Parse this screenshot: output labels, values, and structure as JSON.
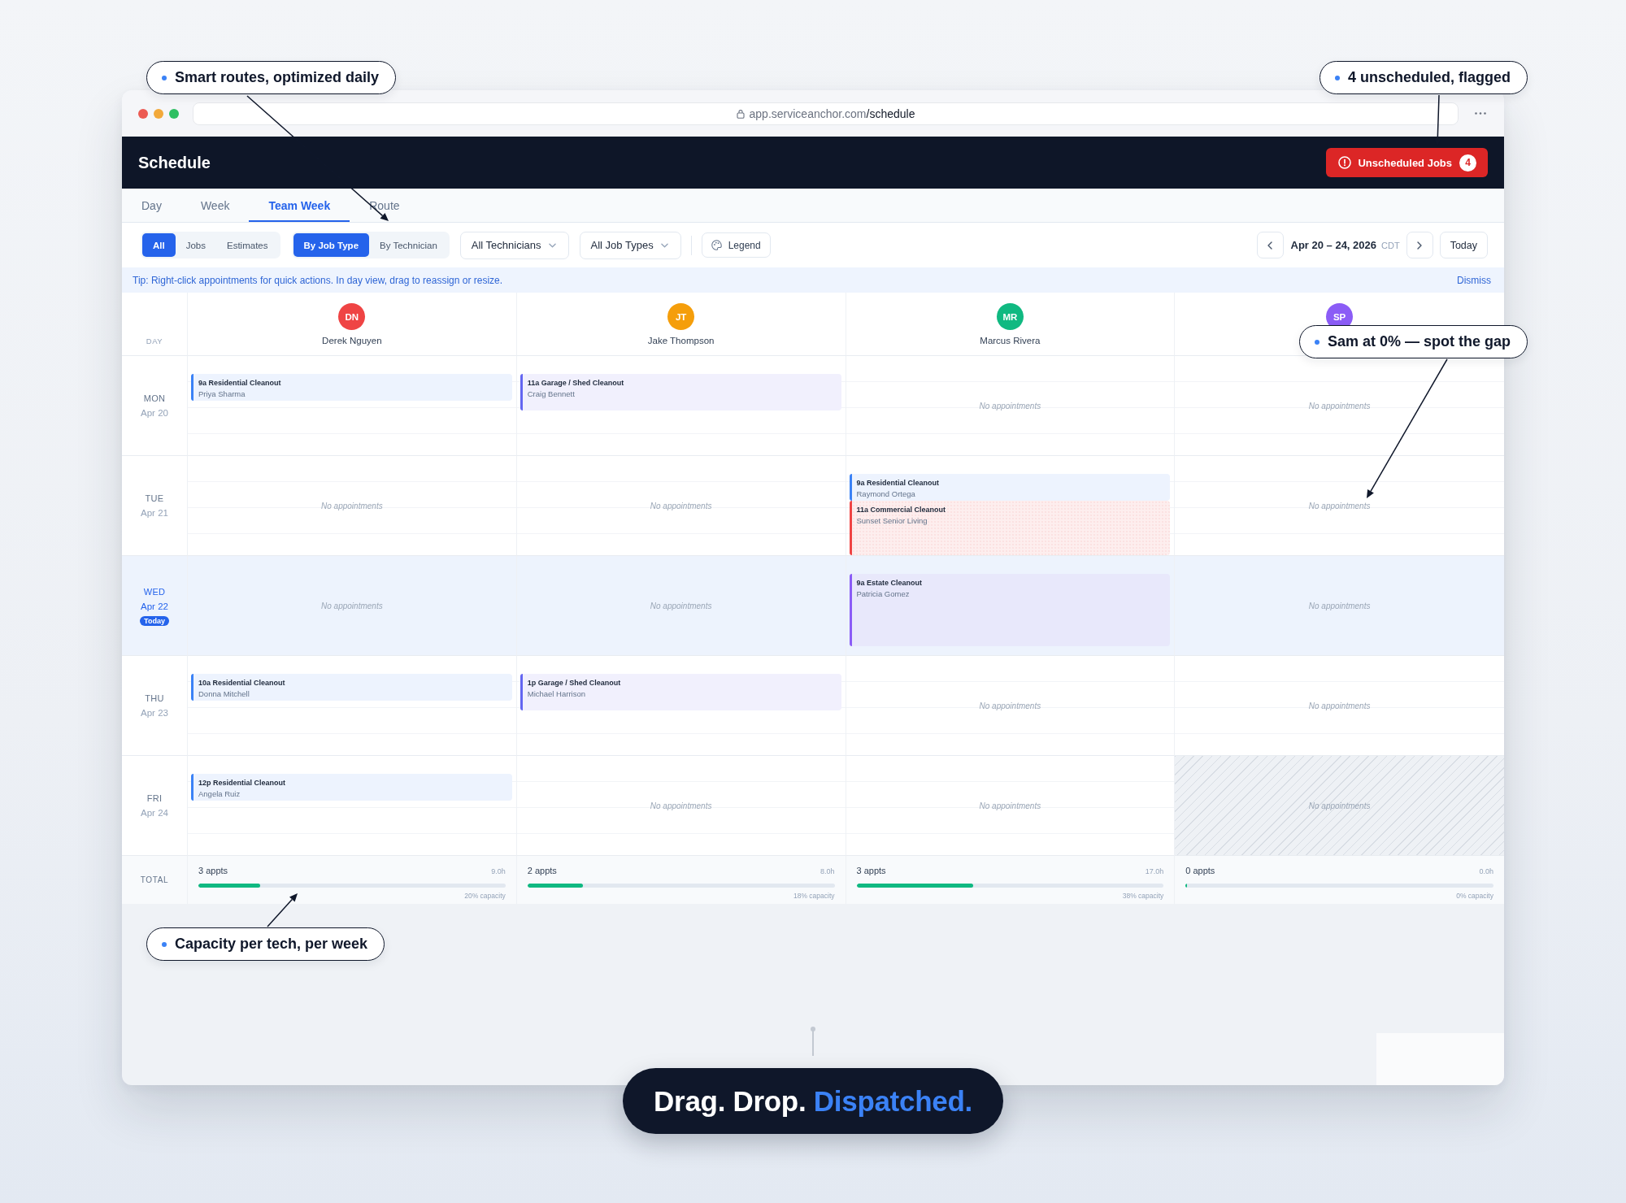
{
  "callouts": [
    {
      "text": "Smart routes, optimized daily"
    },
    {
      "text": "4 unscheduled, flagged"
    },
    {
      "text": "Sam at 0% — spot the gap"
    },
    {
      "text": "Capacity per tech, per week"
    }
  ],
  "browser": {
    "url": {
      "host": "app.serviceanchor.com",
      "path": "/schedule"
    }
  },
  "header": {
    "title": "Schedule",
    "alert_button": {
      "label": "Unscheduled Jobs",
      "count": "4"
    }
  },
  "tabs": [
    {
      "label": "Day",
      "selected": false
    },
    {
      "label": "Week",
      "selected": false
    },
    {
      "label": "Team Week",
      "selected": true
    },
    {
      "label": "Route",
      "selected": false
    }
  ],
  "toolbar": {
    "record_filter": [
      {
        "label": "All",
        "selected": true
      },
      {
        "label": "Jobs",
        "selected": false
      },
      {
        "label": "Estimates",
        "selected": false
      }
    ],
    "color_mode": [
      {
        "label": "By Job Type",
        "selected": true
      },
      {
        "label": "By Technician",
        "selected": false
      }
    ],
    "dropdowns": [
      {
        "value": "All Technicians"
      },
      {
        "value": "All Job Types"
      }
    ],
    "legend_button": "Legend",
    "date_range": "Apr 20 – 24, 2026",
    "timezone": "CDT",
    "today_button": "Today"
  },
  "tip": {
    "text": "Tip: Right-click appointments for quick actions. In day view, drag to reassign or resize.",
    "dismiss": "Dismiss"
  },
  "schedule": {
    "day_heading": "DAY",
    "technicians": [
      {
        "initials": "DN",
        "name": "Derek Nguyen",
        "color": "#ef4444"
      },
      {
        "initials": "JT",
        "name": "Jake Thompson",
        "color": "#f59e0b"
      },
      {
        "initials": "MR",
        "name": "Marcus Rivera",
        "color": "#10b981"
      },
      {
        "initials": "SP",
        "color": "#8b5cf6"
      }
    ],
    "days": [
      {
        "day": "MON",
        "date": "Apr 20",
        "today": false,
        "cells": [
          {
            "off": false,
            "appointments": [
              {
                "kind": "residential",
                "title": "9a Residential Cleanout",
                "client": "Priya Sharma"
              }
            ]
          },
          {
            "off": false,
            "appointments": [
              {
                "kind": "garage",
                "title": "11a Garage / Shed Cleanout",
                "client": "Craig Bennett"
              }
            ]
          },
          {
            "off": false,
            "note": "No appointments"
          },
          {
            "off": false,
            "note": "No appointments"
          }
        ]
      },
      {
        "day": "TUE",
        "date": "Apr 21",
        "today": false,
        "cells": [
          {
            "off": false,
            "note": "No appointments"
          },
          {
            "off": false,
            "note": "No appointments"
          },
          {
            "off": false,
            "appointments": [
              {
                "kind": "residential",
                "title": "9a Residential Cleanout",
                "client": "Raymond Ortega"
              },
              {
                "kind": "commercial",
                "title": "11a Commercial Cleanout",
                "client": "Sunset Senior Living"
              }
            ]
          },
          {
            "off": false,
            "note": "No appointments"
          }
        ]
      },
      {
        "day": "WED",
        "date": "Apr 22",
        "today": true,
        "badge": "Today",
        "cells": [
          {
            "off": false,
            "note": "No appointments"
          },
          {
            "off": false,
            "note": "No appointments"
          },
          {
            "off": false,
            "appointments": [
              {
                "kind": "estate",
                "title": "9a Estate Cleanout",
                "client": "Patricia Gomez"
              }
            ]
          },
          {
            "off": false,
            "note": "No appointments"
          }
        ]
      },
      {
        "day": "THU",
        "date": "Apr 23",
        "today": false,
        "cells": [
          {
            "off": false,
            "appointments": [
              {
                "kind": "residential",
                "title": "10a Residential Cleanout",
                "client": "Donna Mitchell"
              }
            ]
          },
          {
            "off": false,
            "appointments": [
              {
                "kind": "garage",
                "title": "1p Garage / Shed Cleanout",
                "client": "Michael Harrison"
              }
            ]
          },
          {
            "off": false,
            "note": "No appointments"
          },
          {
            "off": false,
            "note": "No appointments"
          }
        ]
      },
      {
        "day": "FRI",
        "date": "Apr 24",
        "today": false,
        "cells": [
          {
            "off": false,
            "appointments": [
              {
                "kind": "residential",
                "title": "12p Residential Cleanout",
                "client": "Angela Ruiz"
              }
            ]
          },
          {
            "off": false,
            "note": "No appointments"
          },
          {
            "off": false,
            "note": "No appointments"
          },
          {
            "off": true,
            "note": "No appointments"
          }
        ]
      }
    ],
    "totals": {
      "label": "TOTAL",
      "items": [
        {
          "appts": "3 appts",
          "hours": "9.0h",
          "level": 0.2,
          "capacity": "20% capacity"
        },
        {
          "appts": "2 appts",
          "hours": "8.0h",
          "level": 0.18,
          "capacity": "18% capacity"
        },
        {
          "appts": "3 appts",
          "hours": "17.0h",
          "level": 0.38,
          "capacity": "38% capacity"
        },
        {
          "appts": "0 appts",
          "hours": "0.0h",
          "level": 0,
          "capacity": "0% capacity"
        }
      ]
    }
  },
  "tagline": {
    "text": "Drag. Drop.",
    "highlight": "Dispatched."
  }
}
